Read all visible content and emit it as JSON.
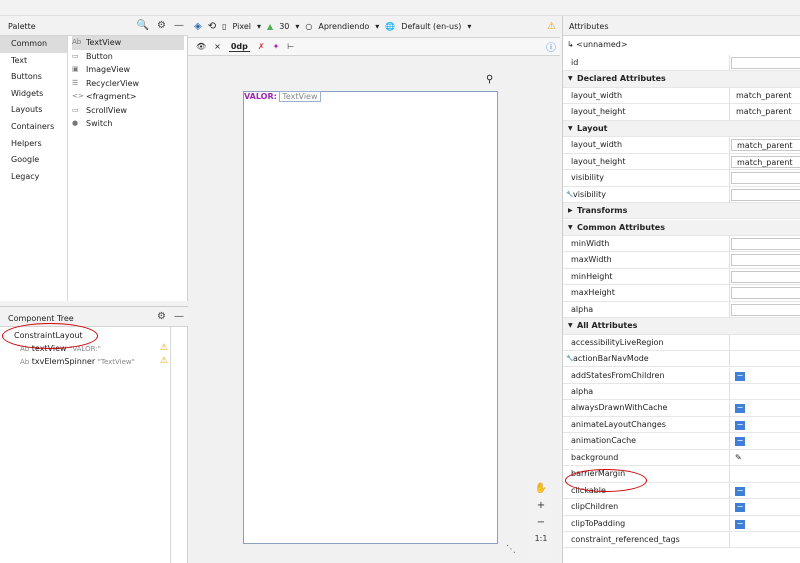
{
  "palette": {
    "title": "Palette",
    "categories": [
      "Common",
      "Text",
      "Buttons",
      "Widgets",
      "Layouts",
      "Containers",
      "Helpers",
      "Google",
      "Legacy"
    ],
    "items": [
      {
        "icon": "Ab",
        "label": "TextView"
      },
      {
        "icon": "▭",
        "label": "Button"
      },
      {
        "icon": "▣",
        "label": "ImageView"
      },
      {
        "icon": "☰",
        "label": "RecyclerView"
      },
      {
        "icon": "<>",
        "label": "<fragment>"
      },
      {
        "icon": "▭",
        "label": "ScrollView"
      },
      {
        "icon": "●",
        "label": "Switch"
      }
    ]
  },
  "tree": {
    "title": "Component Tree",
    "rows": [
      {
        "icon": "",
        "label": "ConstraintLayout",
        "hint": ""
      },
      {
        "icon": "Ab",
        "label": "textView",
        "hint": "\"VALOR:\""
      },
      {
        "icon": "Ab",
        "label": "txvElemSpinner",
        "hint": "\"TextView\""
      }
    ]
  },
  "toolbar": {
    "device": "Pixel",
    "api": "30",
    "theme": "Aprendiendo",
    "locale": "Default (en-us)",
    "margin": "0dp"
  },
  "canvas": {
    "label1": "VALOR:",
    "label2": "TextView"
  },
  "zoom": {
    "plus": "+",
    "minus": "−",
    "ratio": "1:1"
  },
  "attributes": {
    "title": "Attributes",
    "component": "<unnamed>",
    "rows": [
      {
        "label": "id",
        "value": "",
        "type": "input"
      },
      {
        "label": "Declared Attributes",
        "type": "section"
      },
      {
        "label": "layout_width",
        "value": "match_parent",
        "type": "plain"
      },
      {
        "label": "layout_height",
        "value": "match_parent",
        "type": "plain"
      },
      {
        "label": "Layout",
        "type": "section"
      },
      {
        "label": "layout_width",
        "value": "match_parent",
        "type": "input"
      },
      {
        "label": "layout_height",
        "value": "match_parent",
        "type": "input"
      },
      {
        "label": "visibility",
        "value": "",
        "type": "input"
      },
      {
        "label": "visibility",
        "value": "",
        "type": "input",
        "wrench": true
      },
      {
        "label": "Transforms",
        "type": "section",
        "collapsed": true
      },
      {
        "label": "Common Attributes",
        "type": "section"
      },
      {
        "label": "minWidth",
        "value": "",
        "type": "input"
      },
      {
        "label": "maxWidth",
        "value": "",
        "type": "input"
      },
      {
        "label": "minHeight",
        "value": "",
        "type": "input"
      },
      {
        "label": "maxHeight",
        "value": "",
        "type": "input"
      },
      {
        "label": "alpha",
        "value": "",
        "type": "input"
      },
      {
        "label": "All Attributes",
        "type": "section"
      },
      {
        "label": "accessibilityLiveRegion",
        "value": "",
        "type": "plain"
      },
      {
        "label": "actionBarNavMode",
        "value": "",
        "type": "plain",
        "wrench": true
      },
      {
        "label": "addStatesFromChildren",
        "value": "",
        "type": "minus"
      },
      {
        "label": "alpha",
        "value": "",
        "type": "plain"
      },
      {
        "label": "alwaysDrawnWithCache",
        "value": "",
        "type": "minus"
      },
      {
        "label": "animateLayoutChanges",
        "value": "",
        "type": "minus"
      },
      {
        "label": "animationCache",
        "value": "",
        "type": "minus"
      },
      {
        "label": "background",
        "value": "",
        "type": "pen"
      },
      {
        "label": "barrierMargin",
        "value": "",
        "type": "plain"
      },
      {
        "label": "clickable",
        "value": "",
        "type": "minus"
      },
      {
        "label": "clipChildren",
        "value": "",
        "type": "minus"
      },
      {
        "label": "clipToPadding",
        "value": "",
        "type": "minus"
      },
      {
        "label": "constraint_referenced_tags",
        "value": "",
        "type": "plain"
      }
    ]
  },
  "colors": {
    "accent": "#3f7fd6",
    "warning": "#e5a100",
    "annotation": "#d00000"
  }
}
